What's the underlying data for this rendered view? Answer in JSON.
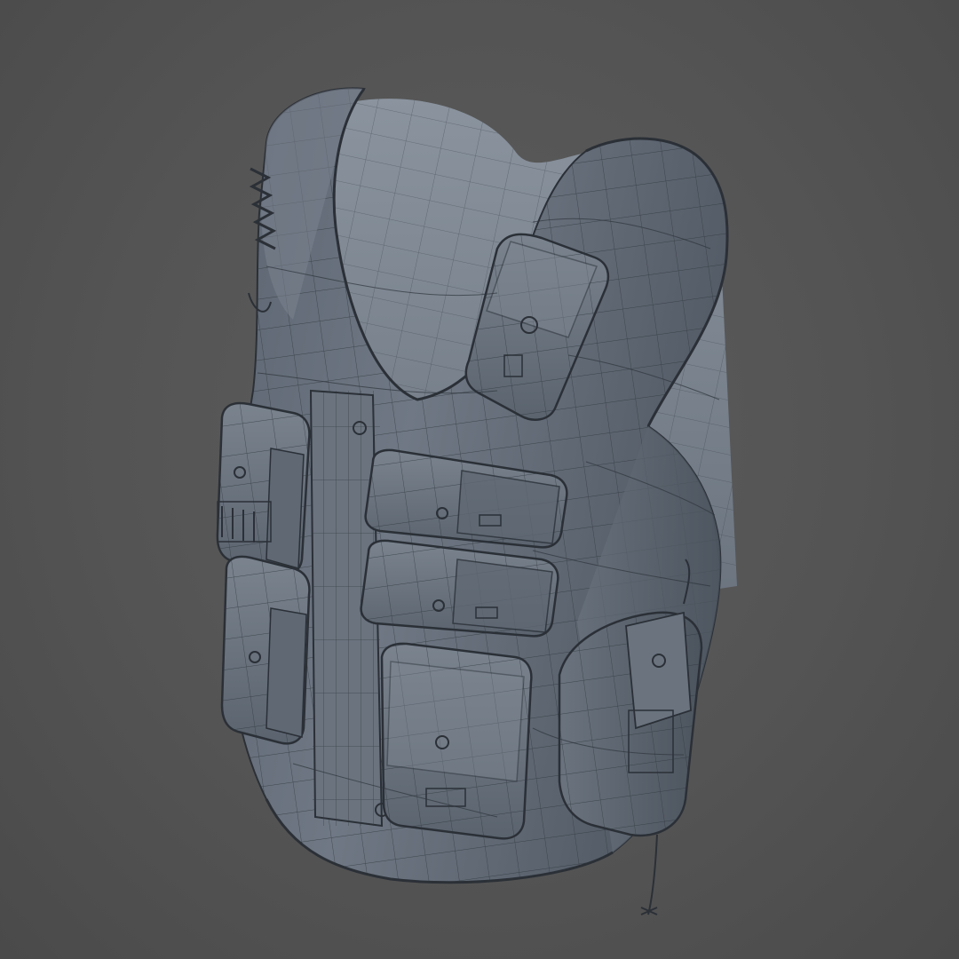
{
  "viewport": {
    "background_color": "#555555",
    "model_base_color": "#6e7784",
    "model_shadow_color": "#4b535e",
    "model_highlight_color": "#8a939e",
    "wireframe_color": "#2f353c"
  },
  "model": {
    "subject": "tactical-vest-wireframe",
    "front_pouches": 4,
    "side_pouches": 2,
    "shoulder_pouches": 1,
    "holster": 1
  }
}
